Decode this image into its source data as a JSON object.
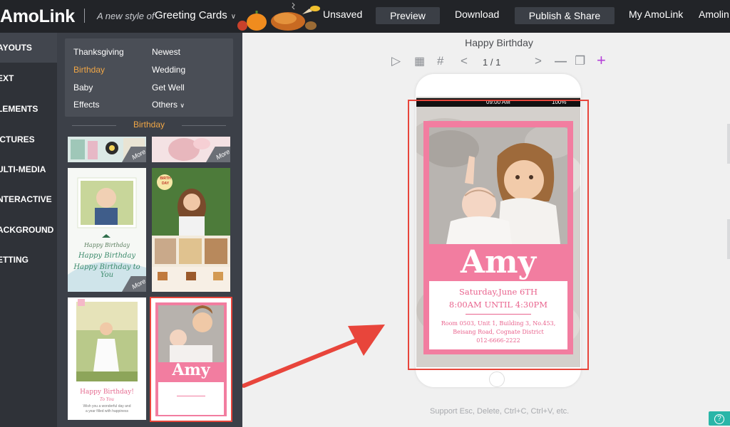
{
  "topbar": {
    "logo": "AmoLink",
    "tagline": "A new style of",
    "category": "Greeting Cards",
    "unsaved": "Unsaved",
    "preview": "Preview",
    "download": "Download",
    "publish": "Publish & Share",
    "my_amolink": "My AmoLink",
    "amolink_cut": "Amolin"
  },
  "leftnav": {
    "items": [
      "AYOUTS",
      "EXT",
      "LEMENTS",
      "ICTURES",
      "ULTI-MEDIA",
      "NTERACTIVE",
      "ACKGROUND",
      "ETTING"
    ]
  },
  "panel": {
    "categories": [
      "Thanksgiving",
      "Newest",
      "Birthday",
      "Wedding",
      "Baby",
      "Get Well",
      "Effects",
      "Others"
    ],
    "section": "Birthday",
    "more_label": "More",
    "tpl_text": {
      "hb1": "Happy Birthday",
      "hb2": "Happy Birthday",
      "hb3": "Happy Birthday to You",
      "hb_pink": "Happy Birthday!",
      "to_you": "To You",
      "wish1": "Wish you a wonderful day and",
      "wish2": "a year filled with happiness",
      "amy": "Amy",
      "badge1": "BIRTH",
      "badge2": "DAY"
    }
  },
  "canvas": {
    "title": "Happy Birthday",
    "page_indicator": "1 / 1",
    "status_time": "09:00 AM",
    "status_battery": "100%",
    "support": "Support Esc, Delete, Ctrl+C, Ctrl+V, etc.",
    "help": "?"
  },
  "card": {
    "name": "Amy",
    "date": "Saturday,June 6TH",
    "time": "8:00AM UNTIL 4:30PM",
    "addr1": "Room 0503, Unit 1, Building 3, No.453,",
    "addr2": "Beisang Road, Cognate District",
    "phone": "012-6666-2222"
  },
  "colors": {
    "accent_orange": "#f0a646",
    "card_pink": "#f27da0",
    "selection_red": "#e8453b",
    "help_teal": "#29b6a8"
  }
}
